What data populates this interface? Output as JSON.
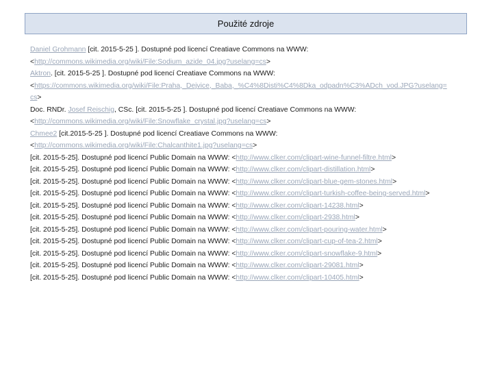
{
  "title": "Použité zdroje",
  "lt": "<",
  "gt": ">",
  "refs": {
    "r1": {
      "author": "Daniel Grohmann",
      "text": " [cit. 2015-5-25 ]. Dostupné pod licencí Creatiave Commons na WWW:",
      "url": "http://commons.wikimedia.org/wiki/File:Sodium_azide_04.jpg?uselang=cs"
    },
    "r2": {
      "author": "Aktron",
      "text": ". [cit. 2015-5-25 ]. Dostupné pod licencí Creatiave Commons na WWW:",
      "url1": "https://commons.wikimedia.org/wiki/File:Praha,_Dejvice,_Baba,_%C4%8Disti%C4%8Dka_odpadn%C3%ADch_vod.JPG?uselang=",
      "url2": "cs"
    },
    "r3": {
      "prefix": "Doc. RNDr. ",
      "author": "Josef Reischig",
      "text": ", CSc. [cit. 2015-5-25 ]. Dostupné pod licencí Creatiave Commons na WWW:",
      "url": "http://commons.wikimedia.org/wiki/File:Snowflake_crystal.jpg?uselang=cs"
    },
    "r4": {
      "author": "Chmee2",
      "text": " [cit.2015-5-25 ]. Dostupné pod licencí Creatiave Commons na WWW:",
      "url": "http://commons.wikimedia.org/wiki/File:Chalcanthite1.jpg?uselang=cs"
    },
    "public_prefix": "[cit. 2015-5-25]. Dostupné pod licencí Public Domain na WWW: ",
    "clipart": [
      "http://www.clker.com/clipart-wine-funnel-filtre.html",
      "http://www.clker.com/clipart-distillation.html",
      "http://www.clker.com/clipart-blue-gem-stones.html",
      "http://www.clker.com/clipart-turkish-coffee-being-served.html",
      "http://www.clker.com/clipart-14238.html",
      "http://www.clker.com/clipart-2938.html",
      "http://www.clker.com/clipart-pouring-water.html",
      "http://www.clker.com/clipart-cup-of-tea-2.html",
      "http://www.clker.com/clipart-snowflake-9.html",
      "http://www.clker.com/clipart-29081.html",
      "http://www.clker.com/clipart-10405.html"
    ]
  }
}
